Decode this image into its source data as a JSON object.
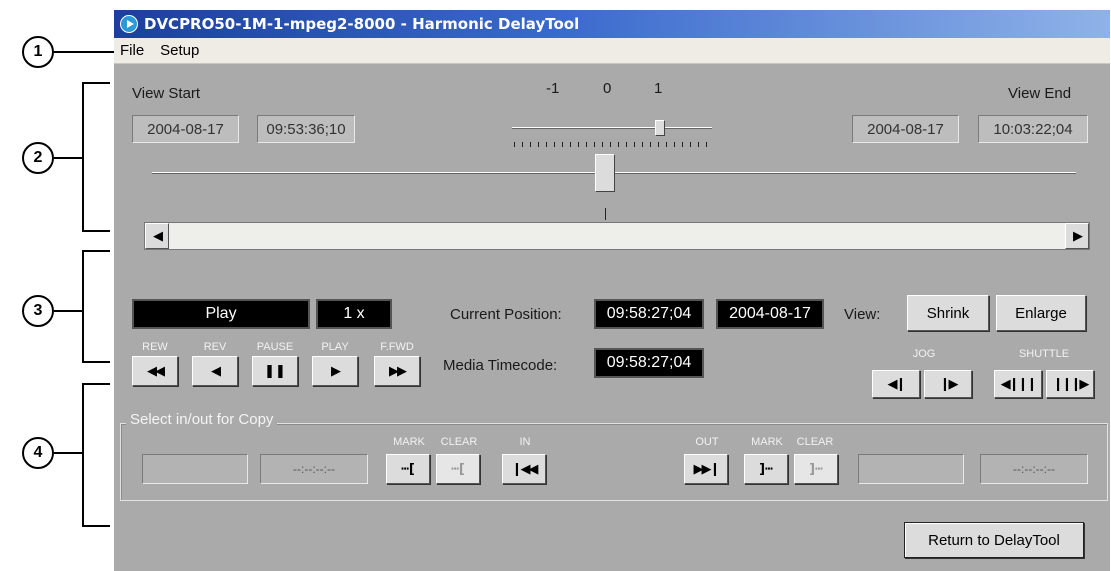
{
  "window": {
    "title": "DVCPRO50-1M-1-mpeg2-8000 - Harmonic DelayTool"
  },
  "menu": {
    "file": "File",
    "setup": "Setup"
  },
  "callouts": [
    "1",
    "2",
    "3",
    "4"
  ],
  "view_range": {
    "start_label": "View Start",
    "start_date": "2004-08-17",
    "start_time": "09:53:36;10",
    "end_label": "View End",
    "end_date": "2004-08-17",
    "end_time": "10:03:22;04"
  },
  "speed_slider": {
    "labels": [
      "-1",
      "0",
      "1"
    ],
    "value": 0.75
  },
  "timeline": {
    "position": 0.49
  },
  "transport": {
    "state": "Play",
    "rate": "1 x",
    "labels": {
      "rew": "REW",
      "rev": "REV",
      "pause": "PAUSE",
      "play": "PLAY",
      "ffwd": "F.FWD"
    },
    "icons": {
      "rew": "rewind-icon",
      "rev": "reverse-icon",
      "pause": "pause-icon",
      "play": "play-icon",
      "ffwd": "fast-forward-icon"
    }
  },
  "position": {
    "current_label": "Current Position:",
    "current_time": "09:58:27;04",
    "current_date": "2004-08-17",
    "media_label": "Media Timecode:",
    "media_time": "09:58:27;04"
  },
  "view": {
    "label": "View:",
    "shrink": "Shrink",
    "enlarge": "Enlarge"
  },
  "jog": {
    "label": "JOG"
  },
  "shuttle": {
    "label": "SHUTTLE"
  },
  "copy": {
    "group_label": "Select in/out for Copy",
    "in_time_placeholder": "--:--:--:--",
    "out_time_placeholder": "--:--:--:--",
    "mark_label": "MARK",
    "clear_label": "CLEAR",
    "in_label": "IN",
    "out_label": "OUT"
  },
  "return_button": "Return to DelayTool",
  "colors": {
    "panel": "#aaaaaa",
    "display_bg": "#000000",
    "title_start": "#1c3f9c",
    "title_end": "#8fb2e8"
  }
}
